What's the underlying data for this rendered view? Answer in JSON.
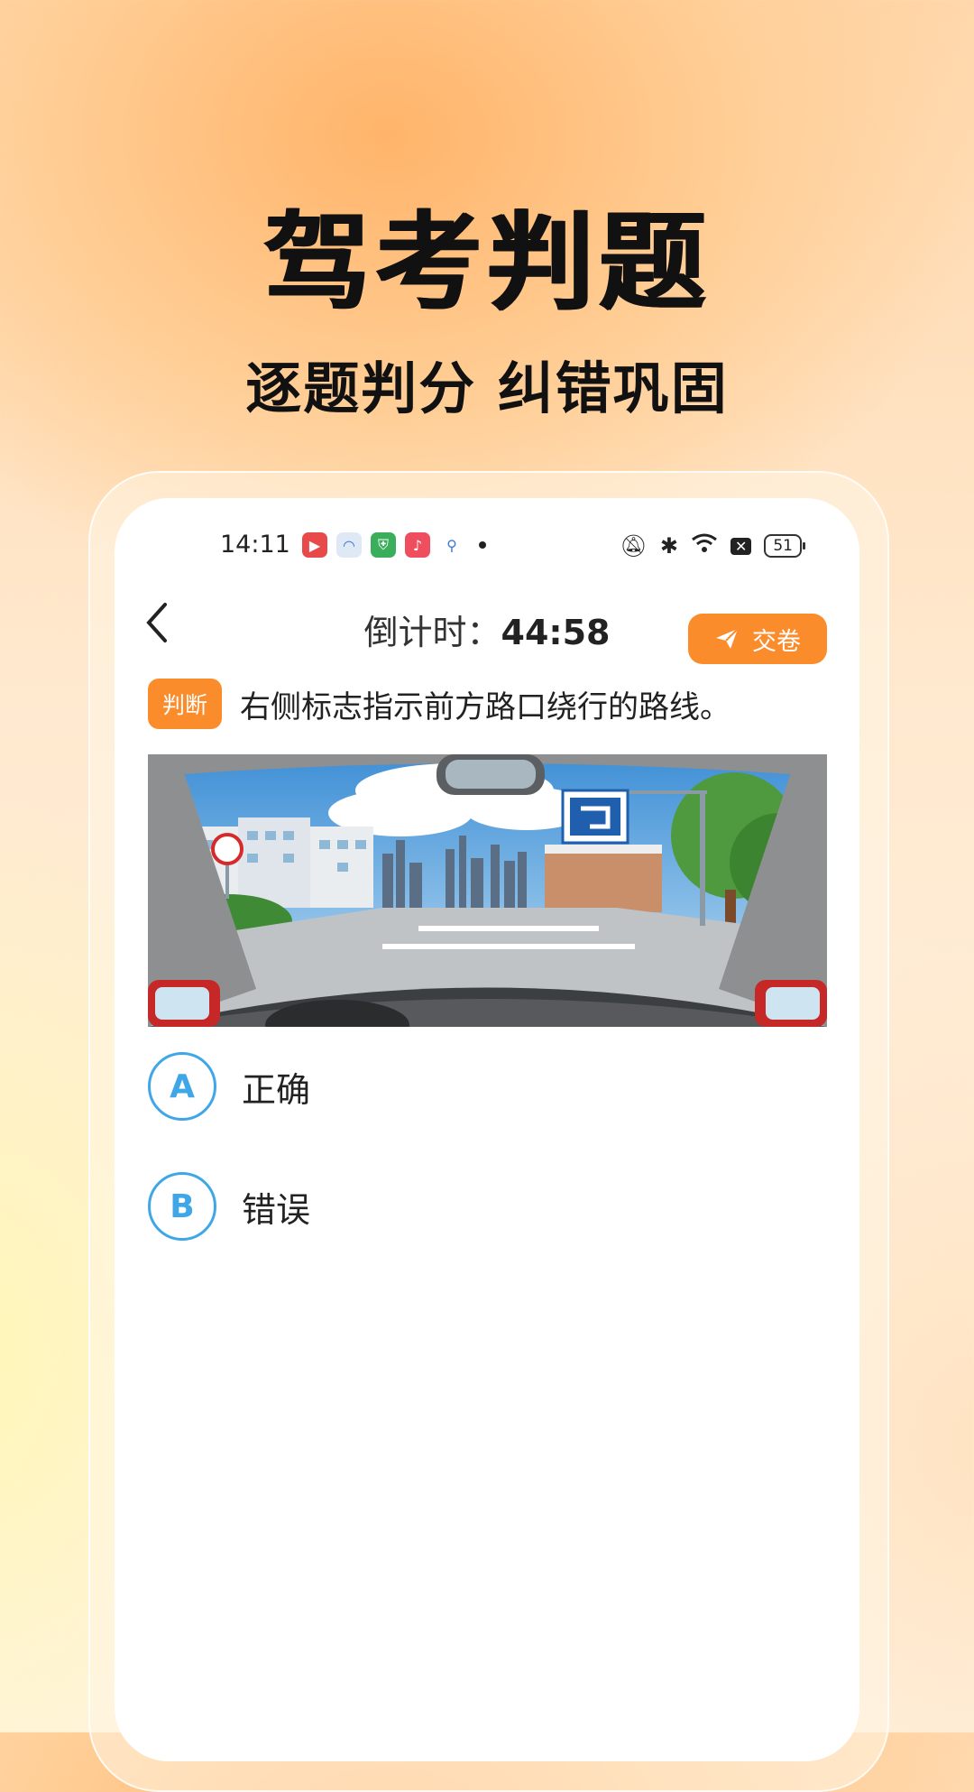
{
  "hero": {
    "title": "驾考判题",
    "subtitle": "逐题判分 纠错巩固"
  },
  "status_bar": {
    "time": "14:11",
    "battery": "51"
  },
  "header": {
    "countdown_label": "倒计时：",
    "countdown_value": "44:58",
    "submit_label": "交卷"
  },
  "question": {
    "type_badge": "判断",
    "text": "右侧标志指示前方路口绕行的路线。"
  },
  "options": [
    {
      "letter": "A",
      "label": "正确"
    },
    {
      "letter": "B",
      "label": "错误"
    }
  ],
  "colors": {
    "accent": "#fb8c2c",
    "option_blue": "#3fa7e8"
  },
  "icons": [
    "chevron-left-icon",
    "paper-plane-icon",
    "mute-icon",
    "bluetooth-icon",
    "wifi-icon",
    "battery-icon"
  ]
}
